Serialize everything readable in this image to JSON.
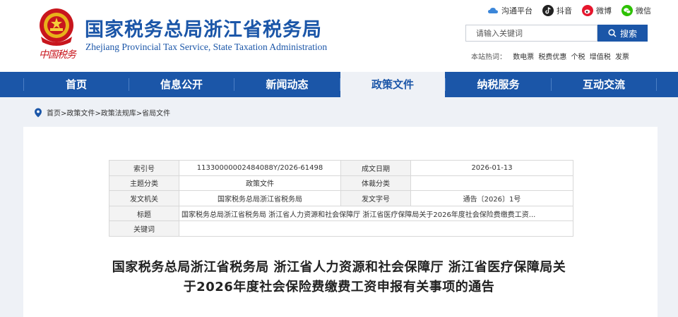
{
  "header": {
    "emblem_text": "中国税务",
    "title": "国家税务总局浙江省税务局",
    "subtitle": "Zhejiang Provincial Tax Service, State Taxation Administration",
    "social": [
      {
        "label": "沟通平台",
        "icon": "cloud-icon",
        "color": "#3b86d9"
      },
      {
        "label": "抖音",
        "icon": "douyin-icon",
        "color": "#222222"
      },
      {
        "label": "微博",
        "icon": "weibo-icon",
        "color": "#e6162d"
      },
      {
        "label": "微信",
        "icon": "wechat-icon",
        "color": "#2dc100"
      }
    ],
    "search": {
      "placeholder": "请输入关键词",
      "button_label": "搜索"
    },
    "hot": {
      "label": "本站热词：",
      "keywords": [
        "数电票",
        "税费优惠",
        "个税",
        "增值税",
        "发票"
      ]
    }
  },
  "nav": {
    "items": [
      "首页",
      "信息公开",
      "新闻动态",
      "政策文件",
      "纳税服务",
      "互动交流"
    ],
    "active_index": 3
  },
  "breadcrumb": {
    "items": [
      "首页",
      "政策文件",
      "政策法规库",
      "省局文件"
    ],
    "separator": ">"
  },
  "meta": {
    "index_label": "索引号",
    "index_value": "11330000002484088Y/2026-61498",
    "date_label": "成文日期",
    "date_value": "2026-01-13",
    "topic_label": "主题分类",
    "topic_value": "政策文件",
    "genre_label": "体裁分类",
    "genre_value": "",
    "issuer_label": "发文机关",
    "issuer_value": "国家税务总局浙江省税务局",
    "doc_no_label": "发文字号",
    "doc_no_value": "通告〔2026〕1号",
    "title_label": "标题",
    "title_value": "国家税务总局浙江省税务局 浙江省人力资源和社会保障厅 浙江省医疗保障局关于2026年度社会保险费缴费工资...",
    "keywords_label": "关键词",
    "keywords_value": ""
  },
  "article": {
    "title_line1": "国家税务总局浙江省税务局 浙江省人力资源和社会保障厅 浙江省医疗保障局关",
    "title_line2": "于2026年度社会保险费缴费工资申报有关事项的通告"
  },
  "colors": {
    "brand_blue": "#1b56a8",
    "emblem_red": "#c8161d",
    "page_bg": "#eef1f6"
  }
}
